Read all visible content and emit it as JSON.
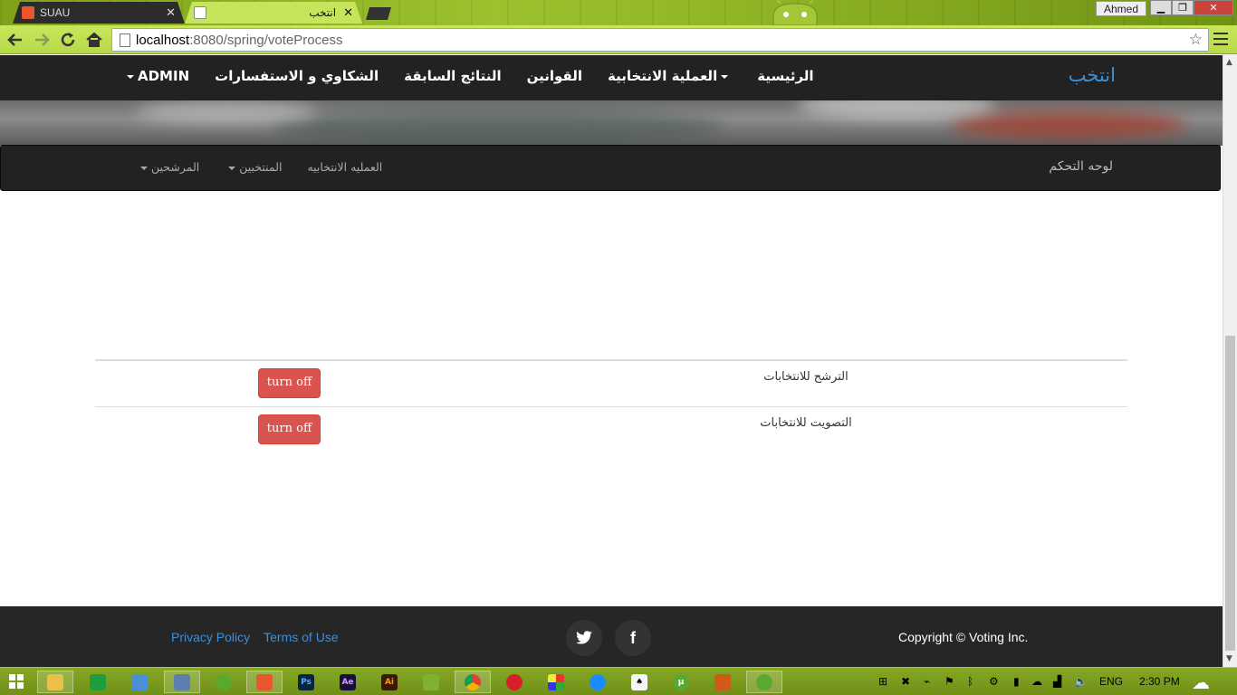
{
  "browser": {
    "tabs": [
      {
        "title": "SUAU",
        "active": false
      },
      {
        "title": "انتخب",
        "active": true
      }
    ],
    "close_glyph": "✕",
    "user_name": "Ahmed",
    "window_buttons": {
      "minimize": "▁",
      "maximize": "❐",
      "close": "✕"
    },
    "url_host": "localhost",
    "url_rest": ":8080/spring/voteProcess",
    "nav_icons": {
      "back": "back-icon",
      "forward": "forward-icon",
      "reload": "reload-icon",
      "home": "home-icon"
    }
  },
  "main_nav": {
    "brand": "انتخب",
    "items": [
      {
        "label": "الرئيسية",
        "dropdown": false
      },
      {
        "label": "العملية الانتخابية",
        "dropdown": true
      },
      {
        "label": "القوانين",
        "dropdown": false
      },
      {
        "label": "النتائج السابقة",
        "dropdown": false
      },
      {
        "label": "الشكاوي و الاستفسارات",
        "dropdown": false
      },
      {
        "label": "ADMIN",
        "dropdown": true
      }
    ]
  },
  "sub_nav": {
    "brand": "لوحه التحكم",
    "items": [
      {
        "label": "العمليه الانتخابيه",
        "dropdown": false
      },
      {
        "label": "المنتخبين",
        "dropdown": true
      },
      {
        "label": "المرشحين",
        "dropdown": true
      }
    ]
  },
  "settings_table": {
    "rows": [
      {
        "label": "الترشح للانتخابات",
        "button": "turn off"
      },
      {
        "label": "التصويت للانتخابات",
        "button": "turn off"
      }
    ]
  },
  "footer": {
    "privacy": "Privacy Policy",
    "terms": "Terms of Use",
    "social": [
      {
        "name": "twitter-icon",
        "glyph": "🐦"
      },
      {
        "name": "facebook-icon",
        "glyph": "f"
      }
    ],
    "copyright": "Copyright © Voting Inc."
  },
  "taskbar": {
    "language": "ENG",
    "time": "2:30 PM"
  },
  "colors": {
    "accent_link": "#3d8fd8",
    "navbar_bg": "#222222",
    "danger": "#d9534f",
    "browser_theme": "#b8d94a"
  }
}
